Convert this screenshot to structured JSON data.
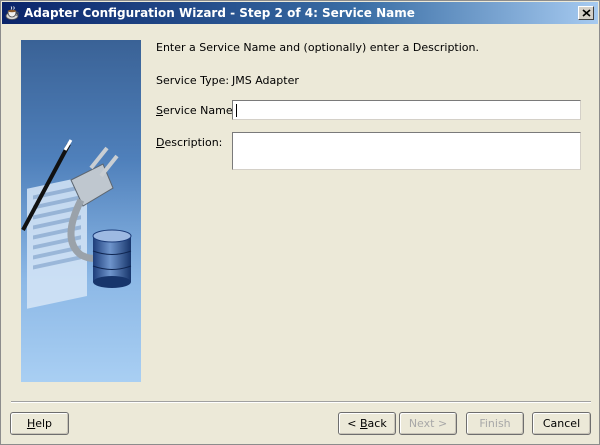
{
  "window": {
    "title": "Adapter Configuration Wizard - Step 2 of 4: Service Name"
  },
  "main": {
    "intro": "Enter a Service Name and (optionally) enter a Description.",
    "service_type_label": "Service Type:",
    "service_type_value": "JMS Adapter",
    "service_name_label_mnemonic": "S",
    "service_name_label_rest": "ervice Name:",
    "service_name_value": "",
    "description_label_mnemonic": "D",
    "description_label_rest": "escription:",
    "description_value": ""
  },
  "buttons": {
    "help_mnemonic": "H",
    "help_rest": "elp",
    "back_prefix": "< ",
    "back_mnemonic": "B",
    "back_rest": "ack",
    "next": "Next >",
    "finish": "Finish",
    "cancel": "Cancel"
  },
  "icons": {
    "app": "coffee-cup-icon",
    "close": "close-icon",
    "banner": "plug-database-illustration"
  }
}
